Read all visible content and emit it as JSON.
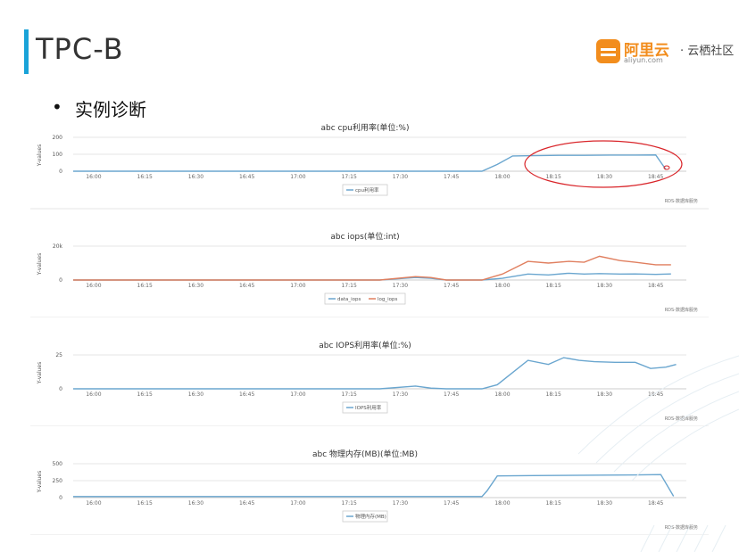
{
  "slide": {
    "title": "TPC-B",
    "bullet": "实例诊断",
    "logo_main": "阿里云",
    "logo_sub": "aliyun.com",
    "logo_community": "· 云栖社区",
    "accent_color": "#1aa3d8",
    "logo_color": "#f28d1d"
  },
  "chart_data": [
    {
      "type": "line",
      "title": "abc cpu利用率(单位:%)",
      "ylabel": "Y-values",
      "ylim": [
        0,
        200
      ],
      "yticks": [
        0,
        100,
        200
      ],
      "ytick_labels": [
        "0",
        "100",
        "200"
      ],
      "categories": [
        "16:00",
        "16:15",
        "16:30",
        "16:45",
        "17:00",
        "17:15",
        "17:30",
        "17:45",
        "18:00",
        "18:15",
        "18:30",
        "18:45"
      ],
      "x": [
        0,
        1,
        2,
        3,
        4,
        5,
        6,
        7,
        8,
        8.3,
        8.6,
        9,
        9.5,
        10,
        10.5,
        11,
        11.4,
        11.6
      ],
      "series": [
        {
          "name": "cpu利用率",
          "color": "#6aa6cf",
          "values": [
            0,
            0,
            0,
            0,
            0,
            0,
            0,
            0,
            0,
            40,
            90,
            92,
            94,
            94,
            95,
            95,
            96,
            10
          ]
        }
      ],
      "credit": "RDS-数据库服务",
      "annotation": "red-ellipse-highlight"
    },
    {
      "type": "line",
      "title": "abc iops(单位:int)",
      "ylabel": "Y-values",
      "ylim": [
        0,
        20000
      ],
      "yticks": [
        0,
        20000
      ],
      "ytick_labels": [
        "0",
        "20k"
      ],
      "categories": [
        "16:00",
        "16:15",
        "16:30",
        "16:45",
        "17:00",
        "17:15",
        "17:30",
        "17:45",
        "18:00",
        "18:15",
        "18:30",
        "18:45"
      ],
      "x": [
        0,
        1,
        2,
        3,
        4,
        5,
        6,
        6.7,
        7,
        7.3,
        8,
        8.4,
        8.9,
        9.3,
        9.7,
        10,
        10.3,
        10.7,
        11,
        11.4,
        11.7
      ],
      "series": [
        {
          "name": "data_iops",
          "color": "#6aa6cf",
          "values": [
            0,
            0,
            0,
            0,
            0,
            0,
            0,
            1500,
            1000,
            0,
            0,
            1000,
            3500,
            3000,
            4000,
            3500,
            3800,
            3500,
            3600,
            3300,
            3600
          ]
        },
        {
          "name": "log_iops",
          "color": "#e07f5f",
          "values": [
            0,
            0,
            0,
            0,
            0,
            0,
            0,
            2000,
            1500,
            0,
            0,
            3500,
            11000,
            10000,
            11000,
            10500,
            14000,
            11500,
            10500,
            9000,
            9000
          ]
        }
      ],
      "credit": "RDS-数据库服务"
    },
    {
      "type": "line",
      "title": "abc IOPS利用率(单位:%)",
      "ylabel": "Y-values",
      "ylim": [
        0,
        25
      ],
      "yticks": [
        0,
        25
      ],
      "ytick_labels": [
        "0",
        "25"
      ],
      "categories": [
        "16:00",
        "16:15",
        "16:30",
        "16:45",
        "17:00",
        "17:15",
        "17:30",
        "17:45",
        "18:00",
        "18:15",
        "18:30",
        "18:45"
      ],
      "x": [
        0,
        1,
        2,
        3,
        4,
        5,
        6,
        6.7,
        7,
        7.3,
        8,
        8.3,
        8.9,
        9.3,
        9.6,
        9.9,
        10.2,
        10.6,
        11,
        11.3,
        11.6,
        11.8
      ],
      "series": [
        {
          "name": "IOPS利用率",
          "color": "#6aa6cf",
          "values": [
            0,
            0,
            0,
            0,
            0,
            0,
            0,
            2,
            0.5,
            0,
            0,
            3,
            21,
            18,
            23,
            21,
            20,
            19.5,
            19.5,
            15,
            16,
            18
          ]
        }
      ],
      "credit": "RDS-数据库服务"
    },
    {
      "type": "line",
      "title": "abc 物理内存(MB)(单位:MB)",
      "ylabel": "Y-values",
      "ylim": [
        0,
        500
      ],
      "yticks": [
        0,
        250,
        500
      ],
      "ytick_labels": [
        "0",
        "250",
        "500"
      ],
      "categories": [
        "16:00",
        "16:15",
        "16:30",
        "16:45",
        "17:00",
        "17:15",
        "17:30",
        "17:45",
        "18:00",
        "18:15",
        "18:30",
        "18:45"
      ],
      "x": [
        0,
        1,
        2,
        3,
        4,
        5,
        6,
        7,
        8,
        8.1,
        8.3,
        9,
        10,
        11,
        11.5,
        11.75
      ],
      "series": [
        {
          "name": "物理内存(MB)",
          "color": "#6aa6cf",
          "values": [
            15,
            15,
            15,
            15,
            15,
            15,
            15,
            15,
            15,
            100,
            320,
            325,
            330,
            335,
            340,
            20
          ]
        }
      ],
      "credit": "RDS-数据库服务"
    }
  ]
}
